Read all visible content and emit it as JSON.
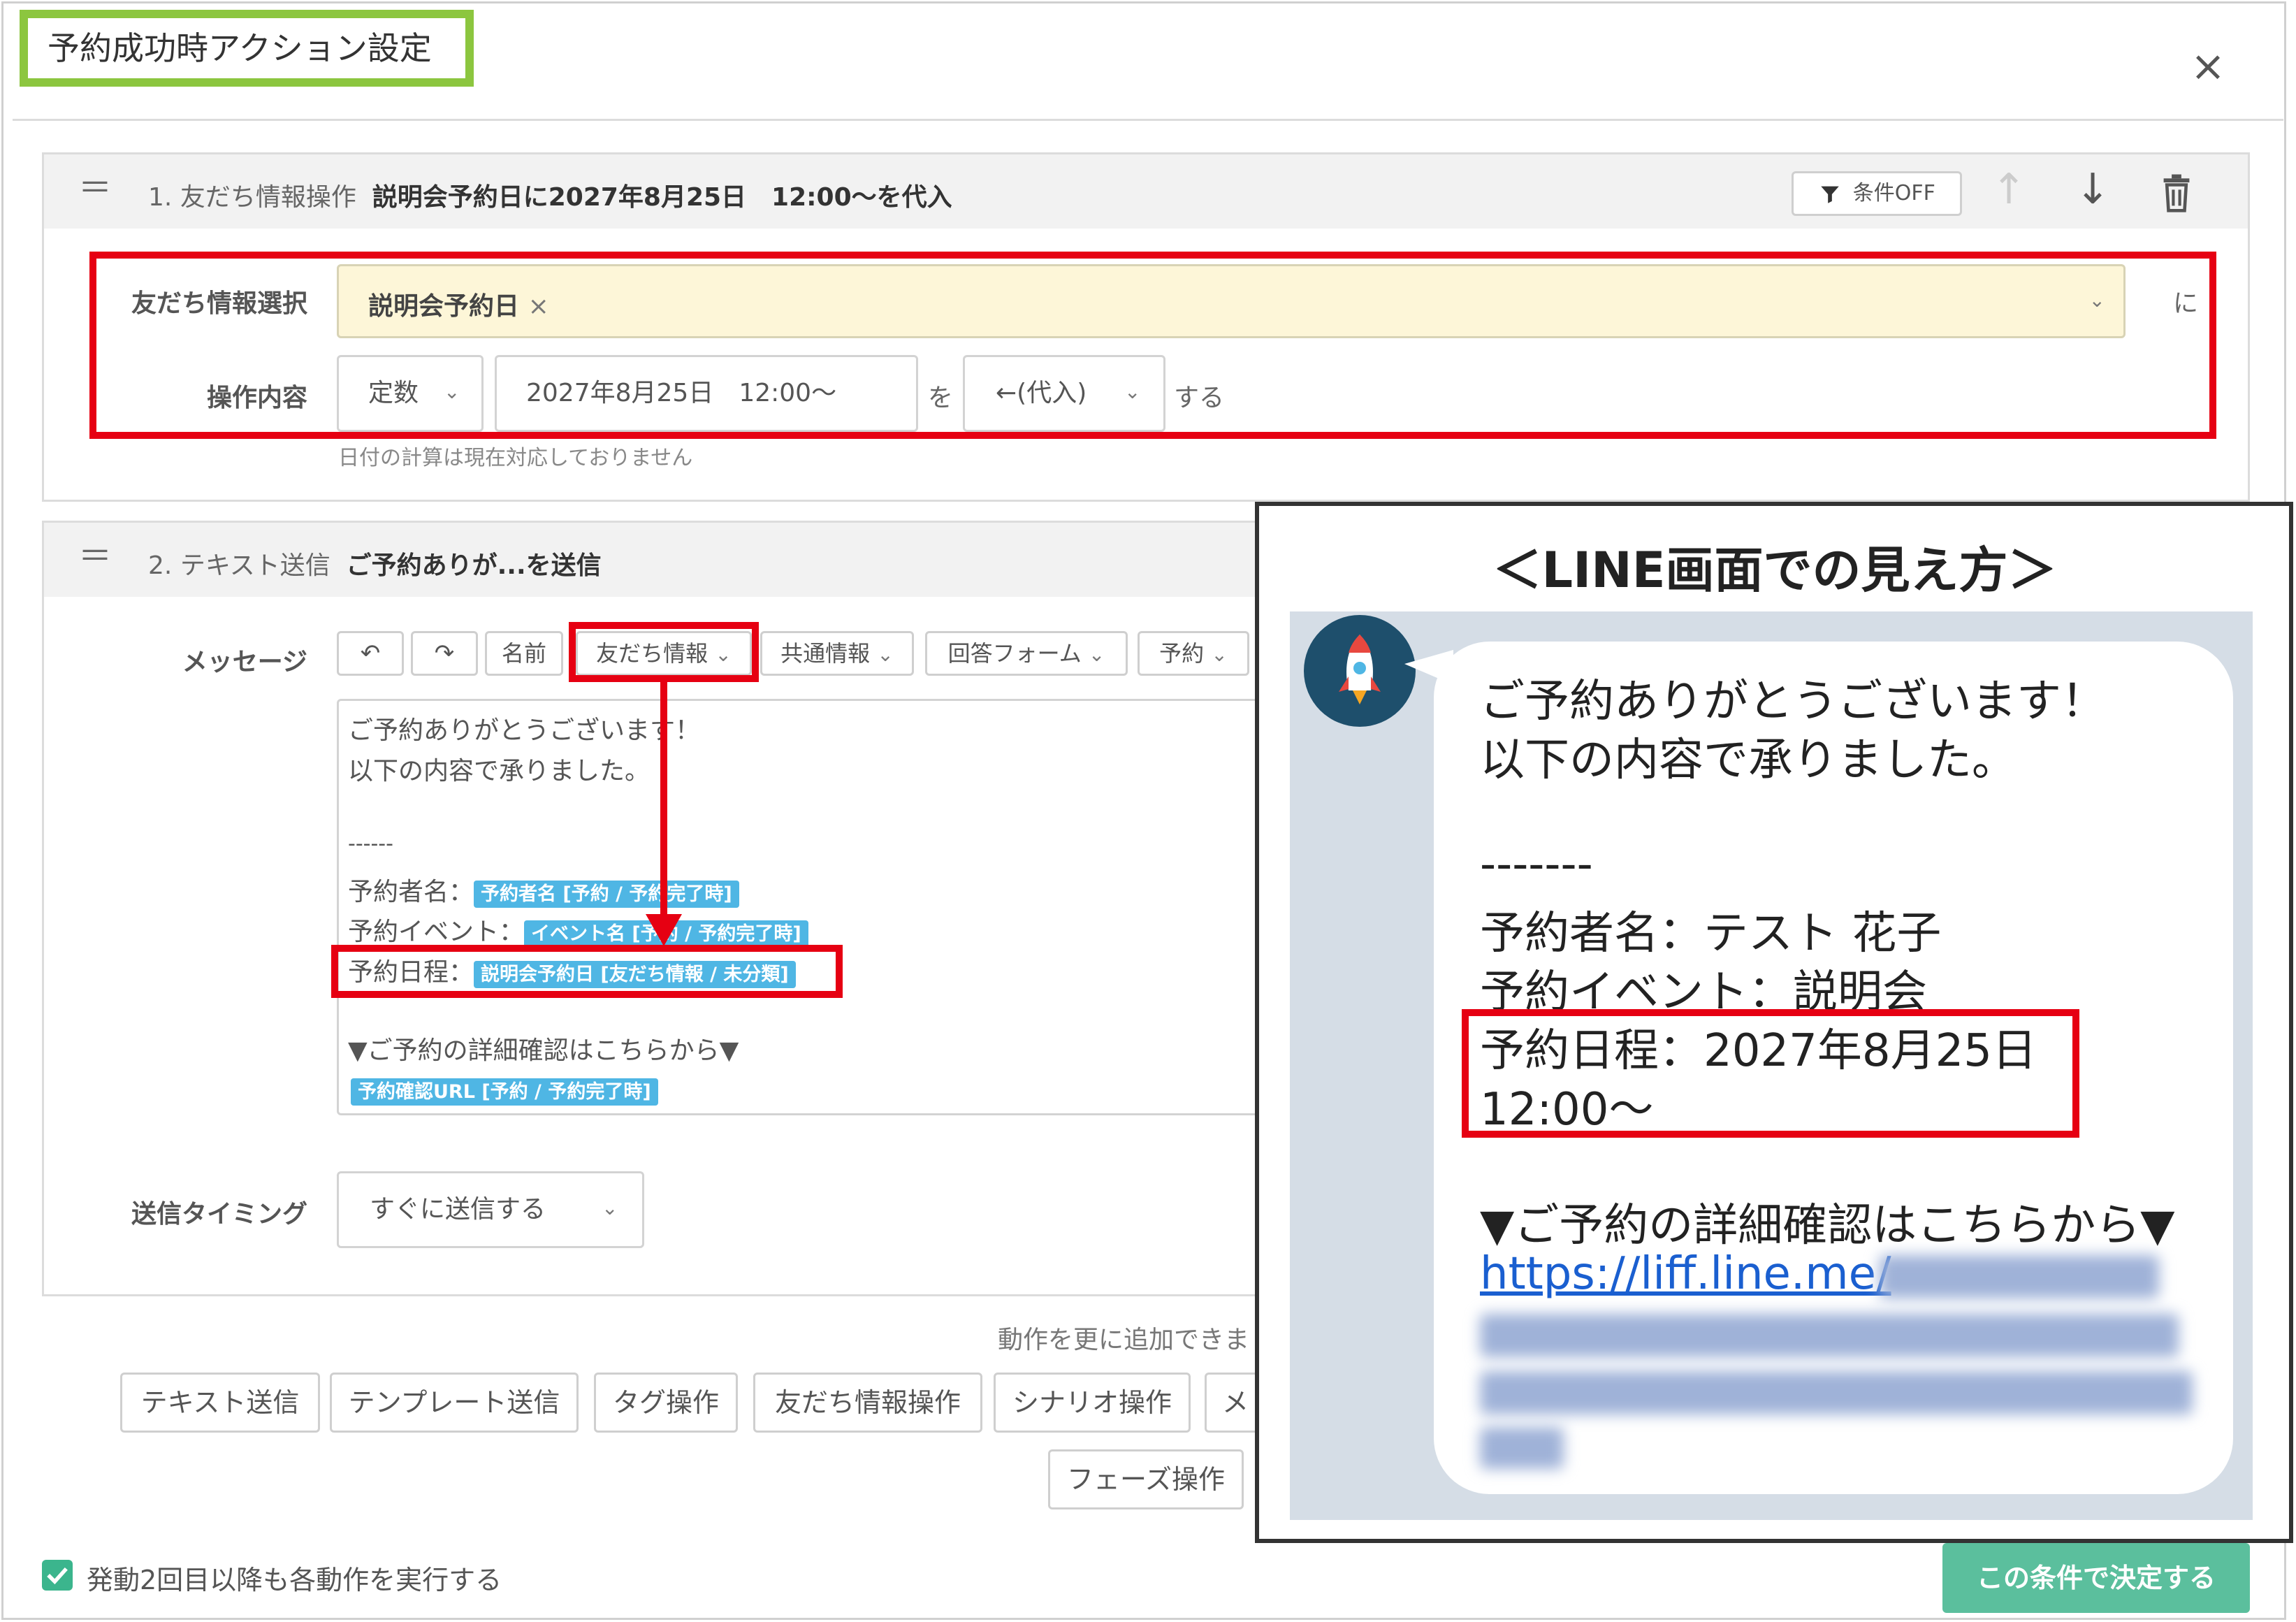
{
  "modal": {
    "title": "予約成功時アクション設定",
    "close_glyph": "×"
  },
  "step1": {
    "handle": "＝",
    "number": "1.",
    "type": "友だち情報操作",
    "summary": "説明会予約日に2027年8月25日　12:00〜を代入",
    "condition_btn": "条件OFF",
    "up_glyph": "↑",
    "down_glyph": "↓",
    "field_label": "友だち情報選択",
    "field_chip": "説明会予約日",
    "chip_remove": "×",
    "field_suffix": "に",
    "op_label": "操作内容",
    "op_type": "定数",
    "op_value": "2027年8月25日　12:00〜",
    "op_particle": "を",
    "op_action": "←(代入)",
    "op_suffix": "する",
    "note": "日付の計算は現在対応しておりません"
  },
  "step2": {
    "handle": "＝",
    "number": "2.",
    "type": "テキスト送信",
    "summary": "ご予約ありが...を送信",
    "message_label": "メッセージ",
    "toolbar": {
      "undo": "↶",
      "redo": "↷",
      "name": "名前",
      "friend_info": "友だち情報",
      "common_info": "共通情報",
      "answer_form": "回答フォーム",
      "reservation": "予約"
    },
    "message": {
      "line1": "ご予約ありがとうございます！",
      "line2": "以下の内容で承りました。",
      "divider": "------",
      "booker_label": "予約者名：",
      "booker_tag": "予約者名 [予約 / 予約完了時]",
      "event_label": "予約イベント：",
      "event_tag": "イベント名 [予約 / 予約完了時]",
      "date_label": "予約日程：",
      "date_tag": "説明会予約日 [友だち情報 / 未分類]",
      "detail_line": "▼ご予約の詳細確認はこちらから▼",
      "url_tag": "予約確認URL [予約 / 予約完了時]"
    },
    "timing_label": "送信タイミング",
    "timing_value": "すぐに送信する"
  },
  "add_actions": {
    "hint": "動作を更に追加できま",
    "buttons": [
      "テキスト送信",
      "テンプレート送信",
      "タグ操作",
      "友だち情報操作",
      "シナリオ操作",
      "メ"
    ],
    "phase_button": "フェーズ操作"
  },
  "footer": {
    "checkbox_label": "発動2回目以降も各動作を実行する",
    "checkbox_checked": true,
    "submit": "この条件で決定する"
  },
  "line_preview": {
    "heading": "＜LINE画面での見え方＞",
    "line1": "ご予約ありがとうございます！",
    "line2": "以下の内容で承りました。",
    "divider": "-------",
    "booker": "予約者名：テスト 花子",
    "event": "予約イベント：説明会",
    "date_line1": "予約日程：2027年8月25日",
    "date_line2": "12:00〜",
    "detail_line": "▼ご予約の詳細確認はこちらから▼",
    "url": "https://liff.line.me/"
  },
  "colors": {
    "highlight_red": "#e60012",
    "title_green": "#8cc63f",
    "tag_blue": "#4fb6e4",
    "submit_green": "#5bbf9d",
    "chip_bg": "#fdf6d8",
    "link_blue": "#1a5fd0"
  }
}
